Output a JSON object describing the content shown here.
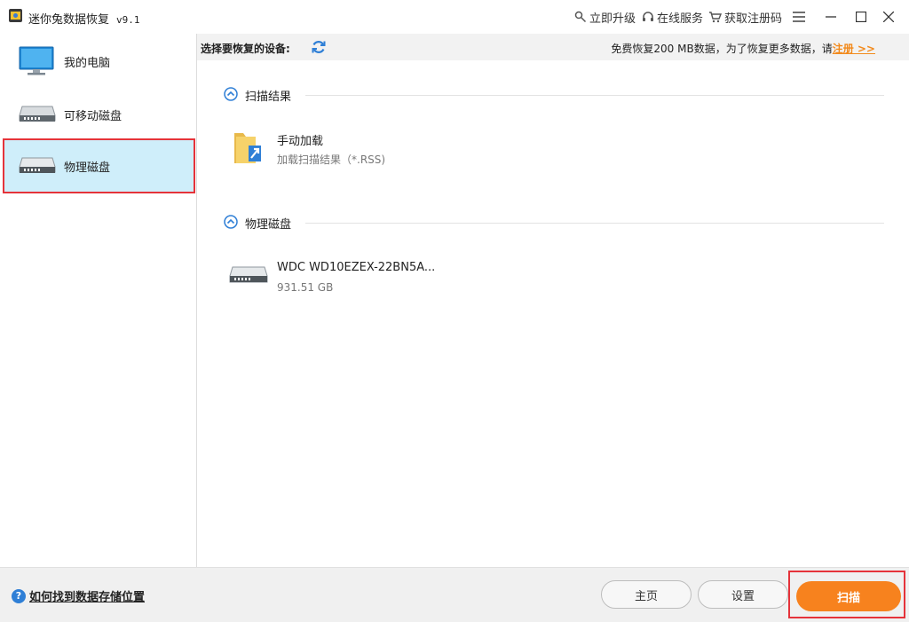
{
  "titlebar": {
    "app_name": "迷你兔数据恢复",
    "version": "v9.1",
    "upgrade": "立即升级",
    "online_service": "在线服务",
    "get_code": "获取注册码"
  },
  "sidebar": {
    "items": [
      {
        "label": "我的电脑",
        "icon": "computer-monitor-icon"
      },
      {
        "label": "可移动磁盘",
        "icon": "removable-disk-icon"
      },
      {
        "label": "物理磁盘",
        "icon": "physical-disk-icon",
        "selected": true
      }
    ]
  },
  "main": {
    "device_title": "选择要恢复的设备:",
    "notice_text": "免费恢复200 MB数据，为了恢复更多数据，请",
    "notice_link": "注册 >>",
    "sections": [
      {
        "title": "扫描结果",
        "entries": [
          {
            "name": "手动加载",
            "sub": "加载扫描结果（*.RSS)",
            "icon": "folder-load-icon"
          }
        ]
      },
      {
        "title": "物理磁盘",
        "entries": [
          {
            "name": "WDC WD10EZEX-22BN5A...",
            "sub": "931.51 GB",
            "icon": "hard-disk-icon"
          }
        ]
      }
    ]
  },
  "footer": {
    "help_text": "如何找到数据存储位置",
    "home_button": "主页",
    "settings_button": "设置",
    "scan_button": "扫描"
  },
  "colors": {
    "accent_orange": "#f7821e",
    "selection_bg": "#cfeefa",
    "highlight_red": "#e5333a",
    "link_blue": "#2f7fd6"
  }
}
